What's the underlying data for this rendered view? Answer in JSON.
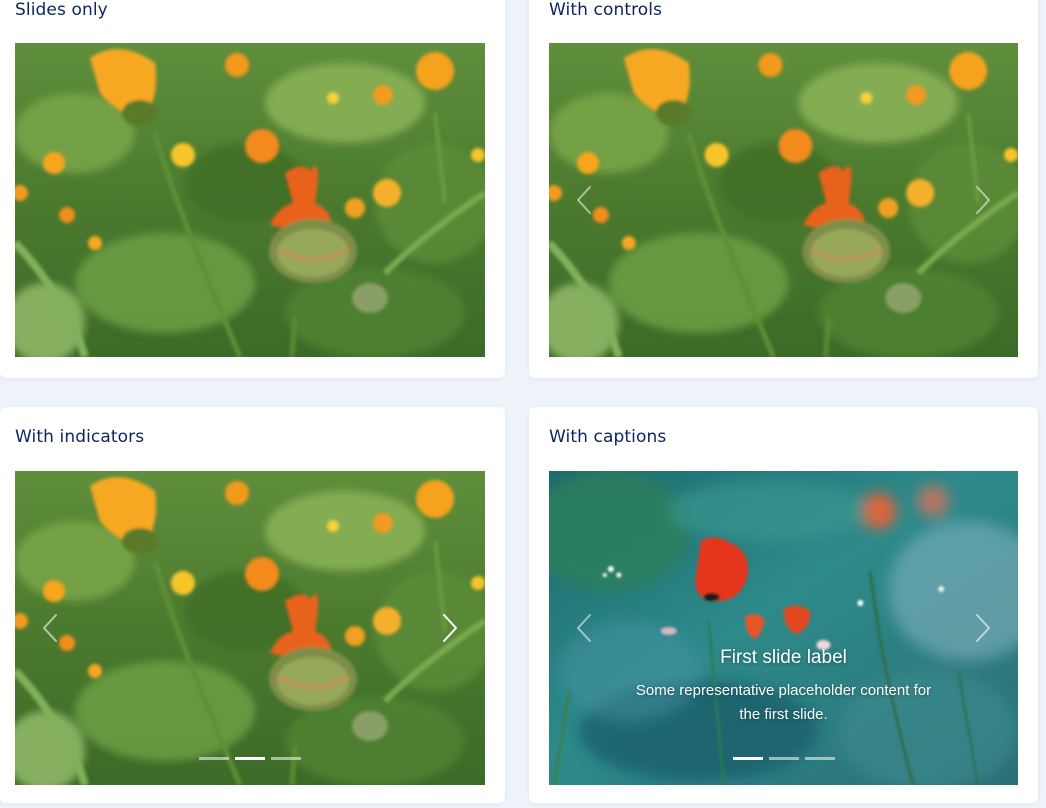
{
  "cards": [
    {
      "title": "Slides only"
    },
    {
      "title": "With controls"
    },
    {
      "title": "With indicators"
    },
    {
      "title": "With captions"
    }
  ],
  "captions_slide": {
    "heading": "First slide label",
    "text": "Some representative placeholder content for the first slide."
  },
  "indicators": {
    "with_indicators": {
      "count": 3,
      "active": 1
    },
    "with_captions": {
      "count": 3,
      "active": 0
    }
  },
  "icons": {
    "prev": "chevron-left-icon",
    "next": "chevron-right-icon"
  },
  "colors": {
    "page_bg": "#eef2f9",
    "card_bg": "#ffffff",
    "title": "#0d2660"
  }
}
